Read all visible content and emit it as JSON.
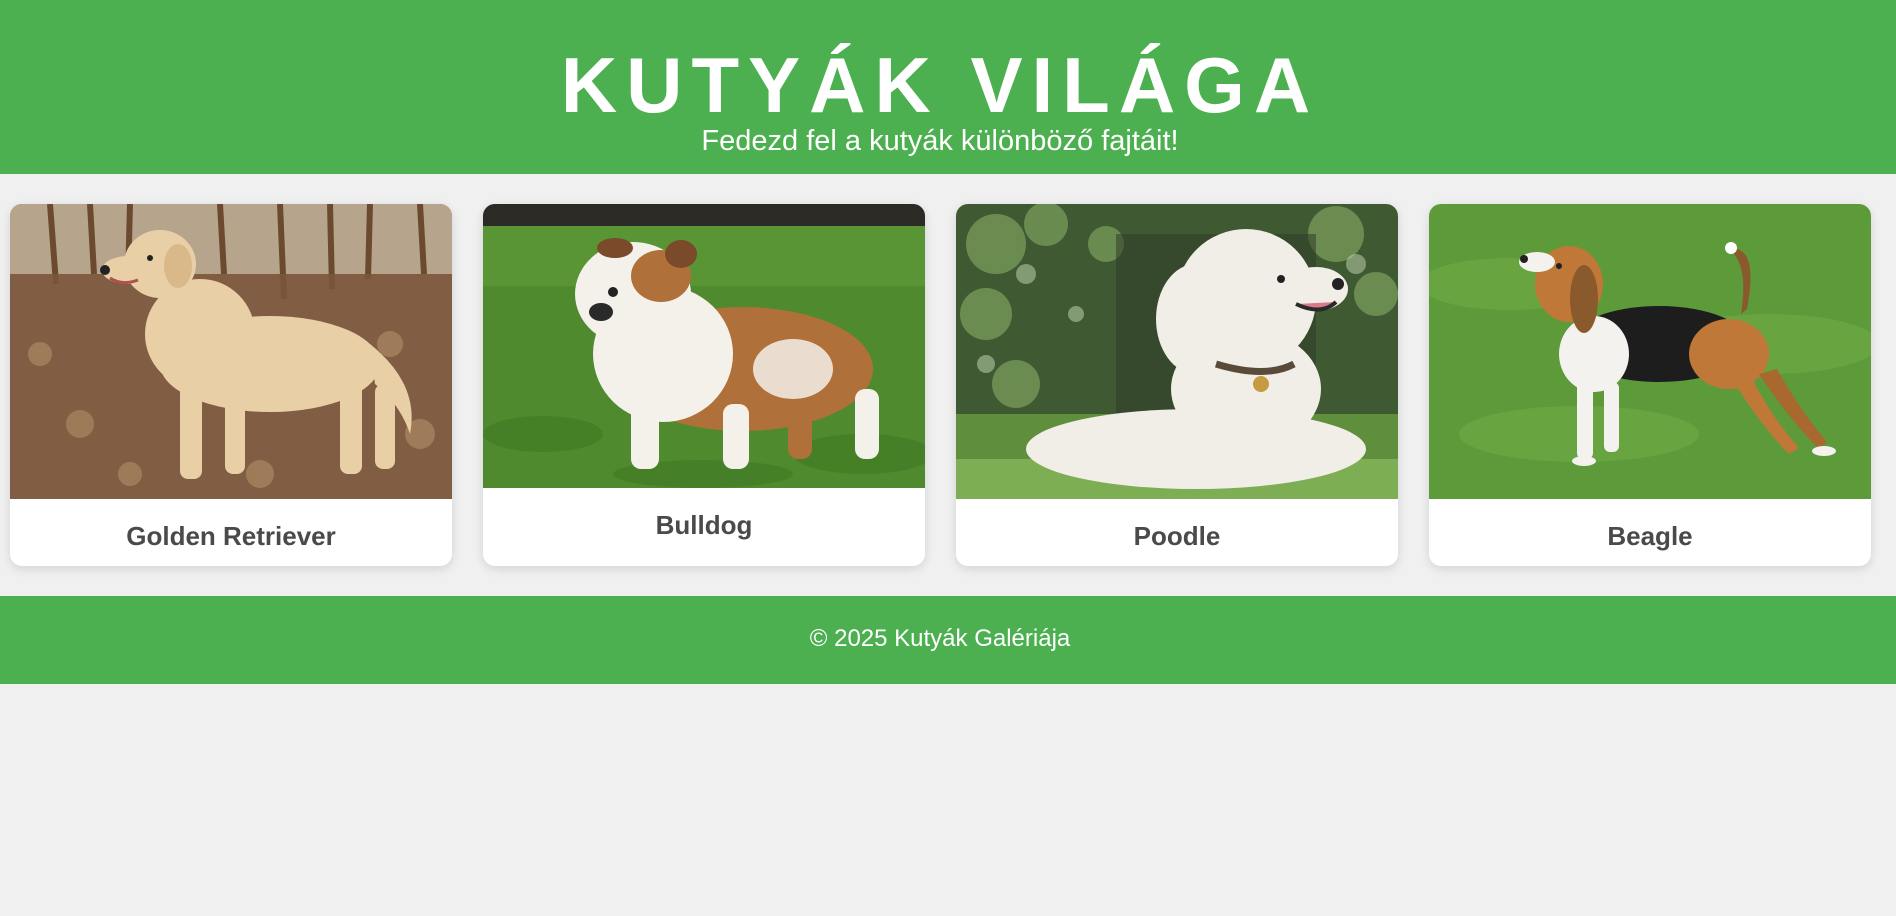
{
  "header": {
    "title": "KUTYÁK VILÁGA",
    "subtitle": "Fedezd fel a kutyák különböző fajtáit!"
  },
  "gallery": {
    "cards": [
      {
        "name": "Golden Retriever",
        "photo_icon": "golden-retriever-photo"
      },
      {
        "name": "Bulldog",
        "photo_icon": "bulldog-photo"
      },
      {
        "name": "Poodle",
        "photo_icon": "poodle-photo"
      },
      {
        "name": "Beagle",
        "photo_icon": "beagle-photo"
      }
    ]
  },
  "footer": {
    "text": "© 2025 Kutyák Galériája"
  },
  "colors": {
    "brand_green": "#4caf50",
    "page_background": "#f0f0f0",
    "card_background": "#ffffff",
    "card_title": "#4a4a4a"
  }
}
